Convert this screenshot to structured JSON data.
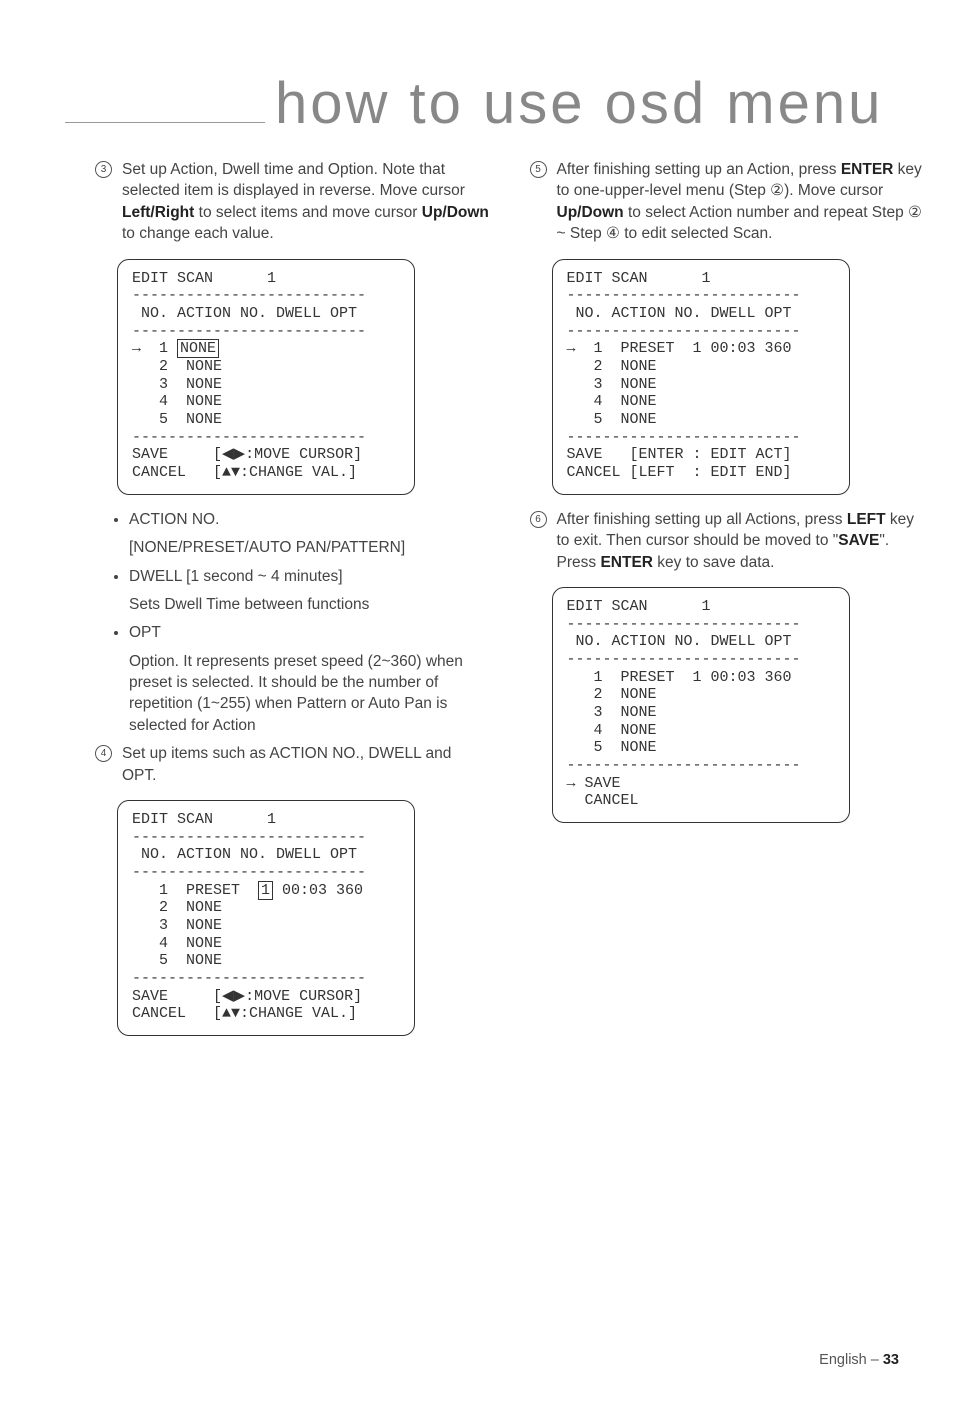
{
  "header": {
    "title": "how to use osd menu"
  },
  "left": {
    "step3": {
      "num": "3",
      "l1a": "Set up Action, Dwell time and Option. Note that selected item is displayed in reverse. Move cursor ",
      "l1b": "Left/Right",
      "l1c": " to select items and move cursor ",
      "l1d": "Up/Down",
      "l1e": " to change each value."
    },
    "osd1": {
      "title": "EDIT SCAN      1",
      "d1": "--------------------------",
      "hdr": " NO. ACTION NO. DWELL OPT",
      "d2": "--------------------------",
      "r1a": "→  1 ",
      "r1b": "NONE",
      "r2": "   2  NONE",
      "r3": "   3  NONE",
      "r4": "   4  NONE",
      "r5": "   5  NONE",
      "d3": "--------------------------",
      "s1": "SAVE     [◀▶:MOVE CURSOR]",
      "s2": "CANCEL   [▲▼:CHANGE VAL.]"
    },
    "bullets": {
      "b1": "ACTION NO.",
      "b1sub": "[NONE/PRESET/AUTO PAN/PATTERN]",
      "b2a": "DWELL",
      "b2b": "    [1 second ~ 4 minutes]",
      "b2sub": "Sets Dwell Time between functions",
      "b3": "OPT",
      "b3sub": "Option. It represents preset speed (2~360) when preset is selected. It should be the number of repetition (1~255) when Pattern or Auto Pan is selected for Action"
    },
    "step4": {
      "num": "4",
      "txt": "Set up items such as ACTION NO., DWELL and OPT."
    },
    "osd2": {
      "title": "EDIT SCAN      1",
      "d1": "--------------------------",
      "hdr": " NO. ACTION NO. DWELL OPT",
      "d2": "--------------------------",
      "r1a": "   1  PRESET  ",
      "r1b": "1",
      "r1c": " 00:03 360",
      "r2": "   2  NONE",
      "r3": "   3  NONE",
      "r4": "   4  NONE",
      "r5": "   5  NONE",
      "d3": "--------------------------",
      "s1": "SAVE     [◀▶:MOVE CURSOR]",
      "s2": "CANCEL   [▲▼:CHANGE VAL.]"
    }
  },
  "right": {
    "step5": {
      "num": "5",
      "l1a": "After finishing setting up an Action, press ",
      "l1b": "ENTER",
      "l1c": " key to one-upper-level menu (Step ②). Move cursor ",
      "l1d": "Up/Down",
      "l1e": " to select Action number and repeat Step ② ~ Step ④ to edit selected Scan."
    },
    "osd3": {
      "title": "EDIT SCAN      1",
      "d1": "--------------------------",
      "hdr": " NO. ACTION NO. DWELL OPT",
      "d2": "--------------------------",
      "r1": "→  1  PRESET  1 00:03 360",
      "r2": "   2  NONE",
      "r3": "   3  NONE",
      "r4": "   4  NONE",
      "r5": "   5  NONE",
      "d3": "--------------------------",
      "s1": "SAVE   [ENTER : EDIT ACT]",
      "s2": "CANCEL [LEFT  : EDIT END]"
    },
    "step6": {
      "num": "6",
      "l1a": "After finishing setting up all Actions, press ",
      "l1b": "LEFT",
      "l1c": " key to exit. Then cursor should be moved to \"",
      "l1d": "SAVE",
      "l1e": "\". Press ",
      "l1f": "ENTER",
      "l1g": " key to save data."
    },
    "osd4": {
      "title": "EDIT SCAN      1",
      "d1": "--------------------------",
      "hdr": " NO. ACTION NO. DWELL OPT",
      "d2": "--------------------------",
      "r1": "   1  PRESET  1 00:03 360",
      "r2": "   2  NONE",
      "r3": "   3  NONE",
      "r4": "   4  NONE",
      "r5": "   5  NONE",
      "d3": "--------------------------",
      "s1": "→ SAVE",
      "s2": "  CANCEL"
    }
  },
  "footer": {
    "lang": "English – ",
    "page": "33"
  }
}
